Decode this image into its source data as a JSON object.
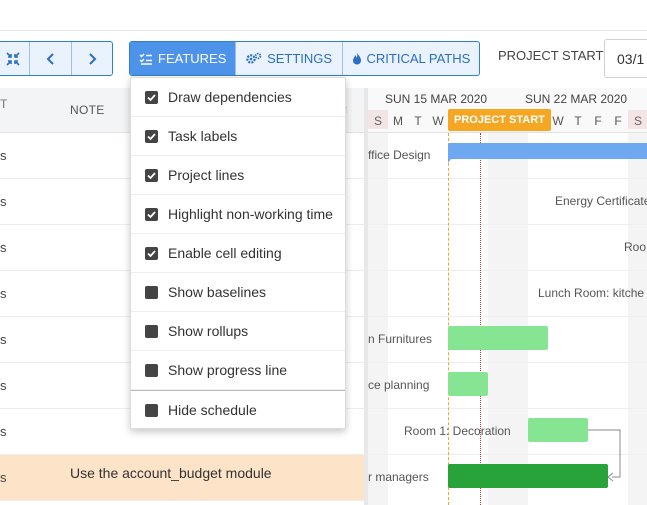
{
  "toolbar": {
    "features_label": "FEATURES",
    "settings_label": "SETTINGS",
    "critical_paths_label": "CRITICAL PATHS",
    "project_start_label": "PROJECT START",
    "project_start_value": "03/1"
  },
  "grid": {
    "note_header": "NOTE",
    "rows": [
      {
        "c1": "s",
        "note": ""
      },
      {
        "c1": "s",
        "note": ""
      },
      {
        "c1": "s",
        "note": ""
      },
      {
        "c1": "s",
        "note": ""
      },
      {
        "c1": "s",
        "note": ""
      },
      {
        "c1": "s",
        "note": ""
      },
      {
        "c1": "s",
        "note": ""
      },
      {
        "c1": "s",
        "note": "Use the account_budget module"
      }
    ]
  },
  "gantt": {
    "weeks": [
      "SUN 15 MAR 2020",
      "SUN 22 MAR 2020"
    ],
    "days": [
      "S",
      "M",
      "T",
      "W",
      "T",
      "F",
      "S",
      "S",
      "M",
      "T",
      "W",
      "T",
      "F",
      "S"
    ],
    "project_start_tag": "PROJECT START",
    "task_labels": [
      "ffice Design",
      "Energy Certificate",
      "Roo",
      "Lunch Room: kitche",
      "n Furnitures",
      "ce planning",
      "Room 1: Decoration",
      "r managers"
    ]
  },
  "menu": {
    "items": [
      {
        "label": "Draw dependencies",
        "checked": true
      },
      {
        "label": "Task labels",
        "checked": true
      },
      {
        "label": "Project lines",
        "checked": true
      },
      {
        "label": "Highlight non-working time",
        "checked": true
      },
      {
        "label": "Enable cell editing",
        "checked": true
      },
      {
        "label": "Show baselines",
        "checked": false
      },
      {
        "label": "Show rollups",
        "checked": false
      },
      {
        "label": "Show progress line",
        "checked": false
      },
      {
        "label": "Hide schedule",
        "checked": false
      }
    ]
  },
  "colors": {
    "accent": "#4e93ea",
    "project_start": "#f5a623",
    "bar_blue": "#6ea8f0",
    "bar_green_light": "#86e592",
    "bar_green_dark": "#27a33a",
    "selected_row": "#fde3c8"
  }
}
